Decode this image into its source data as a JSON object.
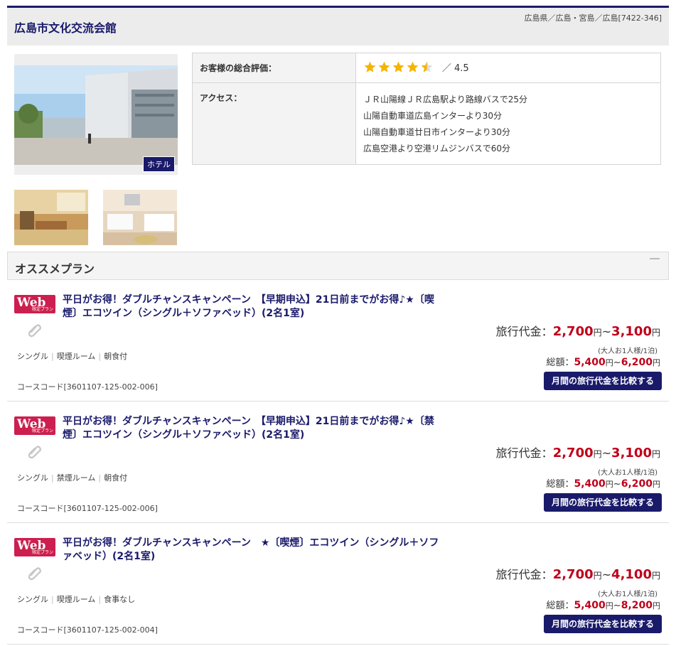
{
  "hotel": {
    "name": "広島市文化交流会館",
    "breadcrumb": "広島県／広島・宮島／広島[7422-346]",
    "badge": "ホテル"
  },
  "info": {
    "rating_label": "お客様の総合評価：",
    "rating_value": 4.5,
    "rating_text": "／ 4.5",
    "access_label": "アクセス：",
    "access_lines": [
      "ＪＲ山陽線ＪＲ広島駅より路線バスで25分",
      "山陽自動車道広島インターより30分",
      "山陽自動車道廿日市インターより30分",
      "広島空港より空港リムジンバスで60分"
    ]
  },
  "plans_section": {
    "title": "オススメプラン"
  },
  "plans": [
    {
      "badge": "Web",
      "badge_sub": "限定プラン",
      "title": "平日がお得！ダブルチャンスキャンペーン　【早期申込】21日前までがお得♪★〔喫煙〕エコツイン（シングル＋ソファベッド）(2名1室)",
      "tags": [
        "シングル",
        "喫煙ルーム",
        "朝食付"
      ],
      "course_code": "コースコード[3601107-125-002-006]",
      "price_label": "旅行代金：",
      "price_min": "2,700",
      "price_max": "3,100",
      "yen": "円",
      "tilde": "~",
      "price_note": "(大人お1人様/1泊)",
      "total_label": "総額：",
      "total_min": "5,400",
      "total_max": "6,200",
      "button": "月間の旅行代金を比較する"
    },
    {
      "badge": "Web",
      "badge_sub": "限定プラン",
      "title": "平日がお得！ダブルチャンスキャンペーン　【早期申込】21日前までがお得♪★〔禁煙〕エコツイン（シングル＋ソファベッド）(2名1室)",
      "tags": [
        "シングル",
        "禁煙ルーム",
        "朝食付"
      ],
      "course_code": "コースコード[3601107-125-002-006]",
      "price_label": "旅行代金：",
      "price_min": "2,700",
      "price_max": "3,100",
      "yen": "円",
      "tilde": "~",
      "price_note": "(大人お1人様/1泊)",
      "total_label": "総額：",
      "total_min": "5,400",
      "total_max": "6,200",
      "button": "月間の旅行代金を比較する"
    },
    {
      "badge": "Web",
      "badge_sub": "限定プラン",
      "title": "平日がお得！ダブルチャンスキャンペーン　★〔喫煙〕エコツイン（シングル＋ソファベッド）(2名1室)",
      "tags": [
        "シングル",
        "喫煙ルーム",
        "食事なし"
      ],
      "course_code": "コースコード[3601107-125-002-004]",
      "price_label": "旅行代金：",
      "price_min": "2,700",
      "price_max": "4,100",
      "yen": "円",
      "tilde": "~",
      "price_note": "(大人お1人様/1泊)",
      "total_label": "総額：",
      "total_min": "5,400",
      "total_max": "8,200",
      "button": "月間の旅行代金を比較する"
    }
  ],
  "colors": {
    "navy": "#1a1a6b",
    "price_red": "#c0001a",
    "web_badge": "#cc1f4f",
    "star": "#f5b400"
  }
}
